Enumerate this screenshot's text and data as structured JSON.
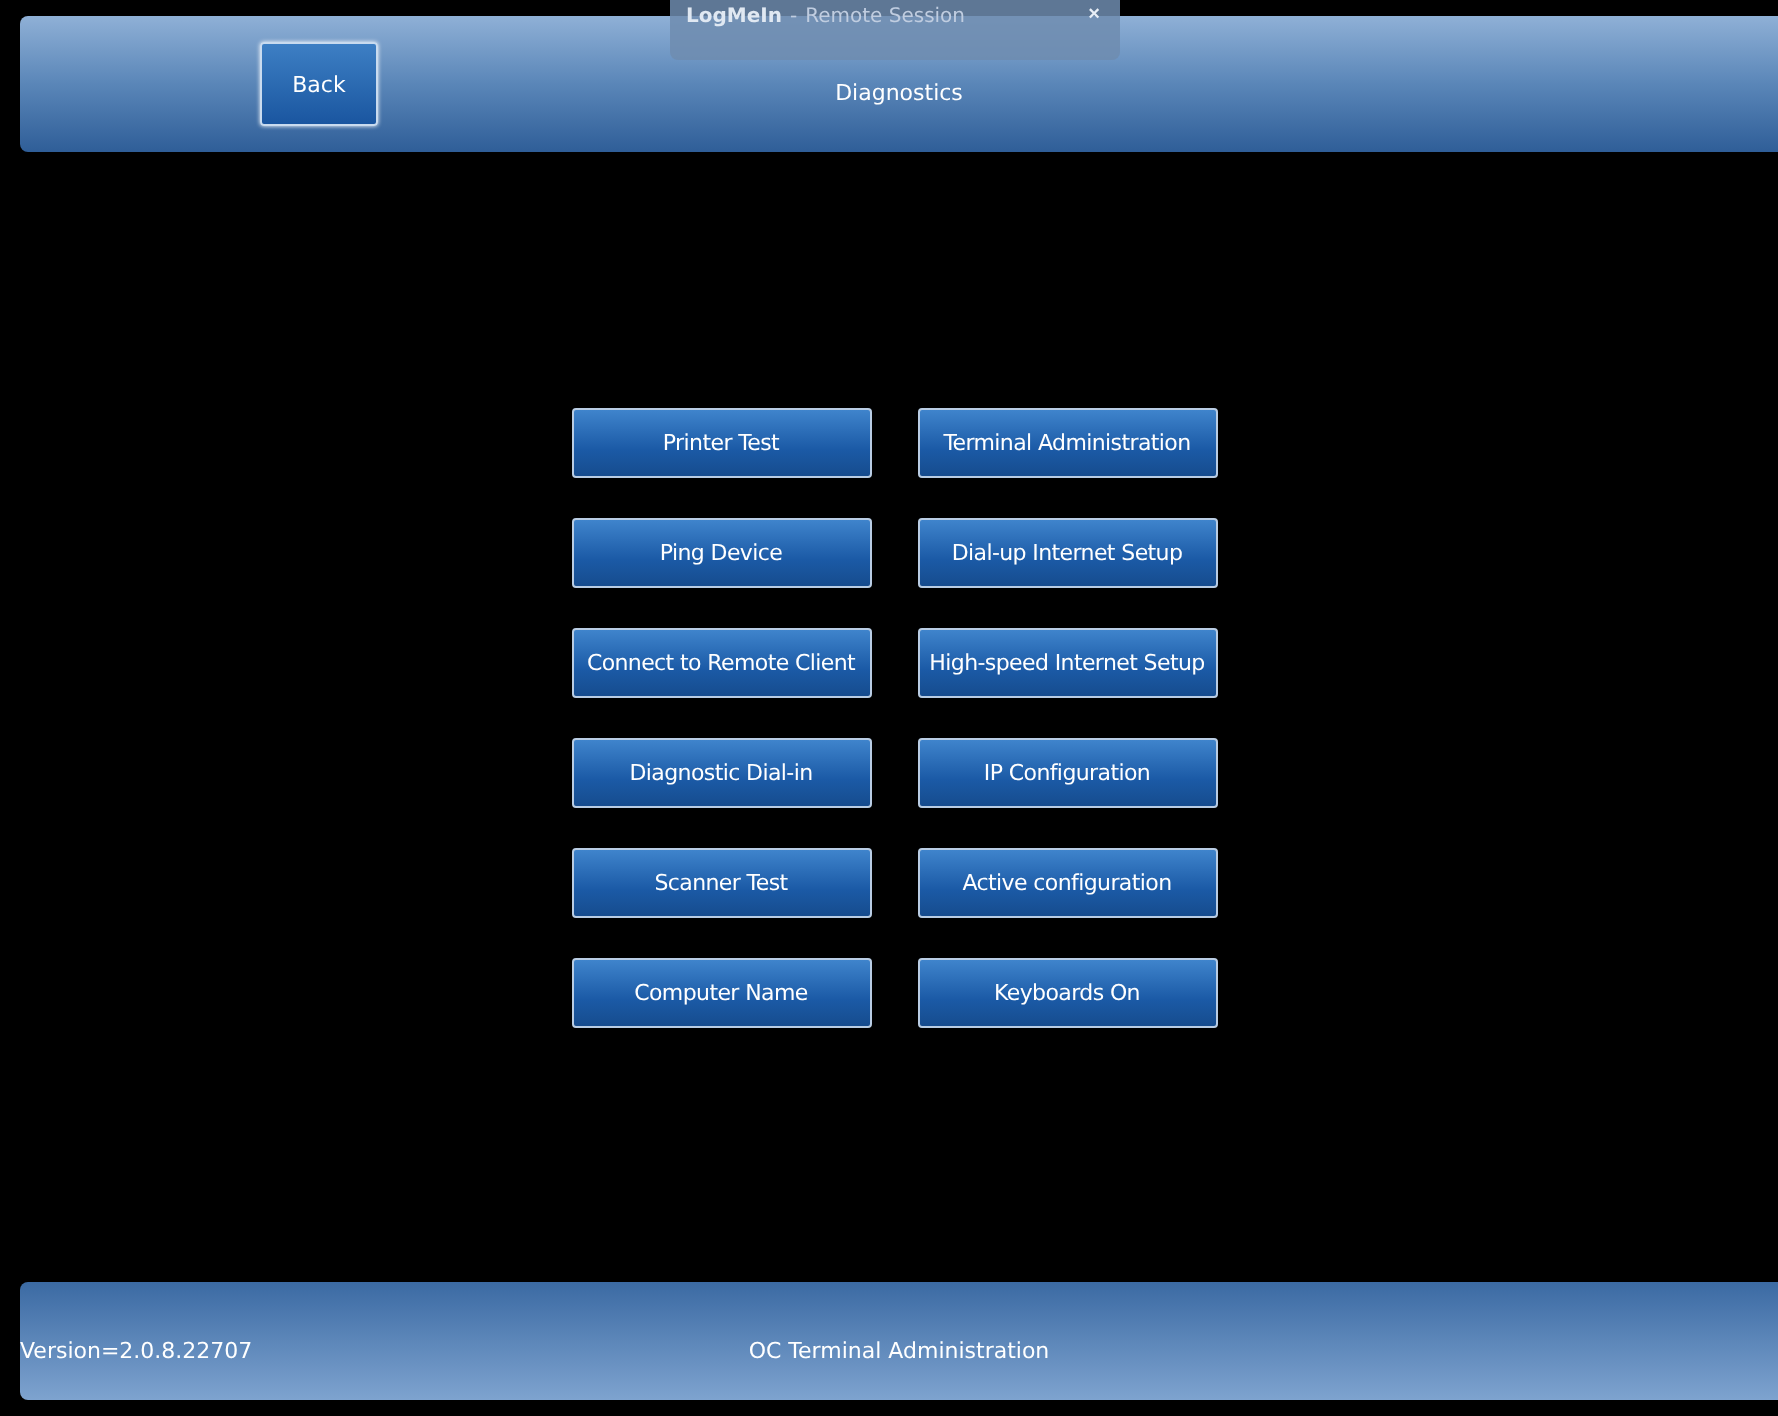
{
  "remote_session_bar": {
    "app_name": "LogMeIn",
    "separator": "-",
    "session_label": "Remote Session",
    "close": "×"
  },
  "header": {
    "back_button": "Back",
    "title": "Diagnostics"
  },
  "buttons": [
    {
      "label": "Printer Test"
    },
    {
      "label": "Terminal Administration"
    },
    {
      "label": "Ping Device"
    },
    {
      "label": "Dial-up Internet Setup"
    },
    {
      "label": "Connect to Remote Client"
    },
    {
      "label": "High-speed Internet Setup"
    },
    {
      "label": "Diagnostic Dial-in"
    },
    {
      "label": "IP Configuration"
    },
    {
      "label": "Scanner Test"
    },
    {
      "label": "Active configuration"
    },
    {
      "label": "Computer Name"
    },
    {
      "label": "Keyboards On"
    }
  ],
  "status_bar": {
    "version": "Version=2.0.8.22707",
    "app_title": "OC Terminal Administration"
  }
}
